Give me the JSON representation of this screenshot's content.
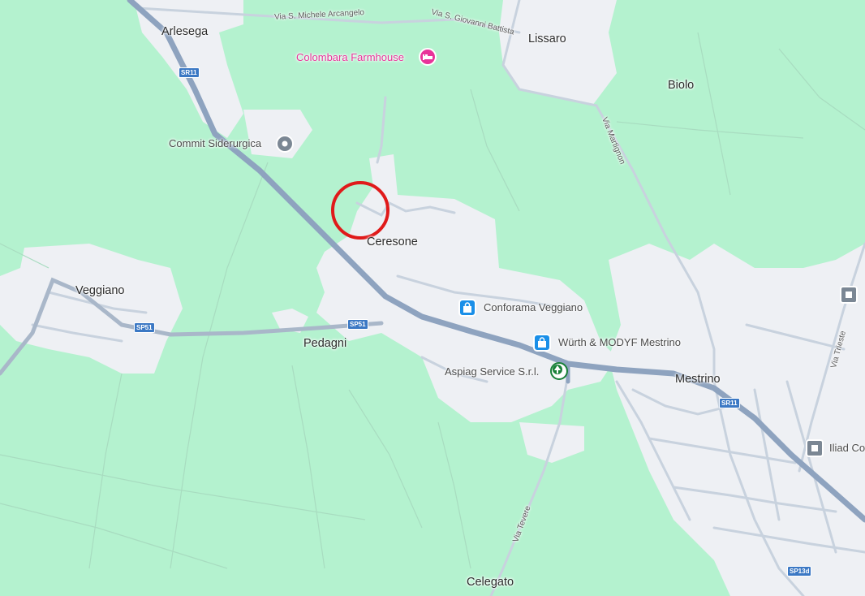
{
  "map": {
    "colors": {
      "land": "#b4f2cf",
      "urban": "#eef0f4",
      "highway": "#8ea3bf",
      "road": "#c8d2de",
      "shopping": "#1a8fe8",
      "lodging": "#e8349a",
      "grocery": "#188038",
      "marker": "#e01a1a"
    },
    "places": {
      "arlesega": "Arlesega",
      "lissaro": "Lissaro",
      "biolo": "Biolo",
      "ceresone": "Ceresone",
      "veggiano": "Veggiano",
      "pedagni": "Pedagni",
      "mestrino": "Mestrino",
      "celegato": "Celegato"
    },
    "streets": {
      "via_s_michele": "Via S. Michele Arcangelo",
      "via_s_giovanni": "Via S. Giovanni Battista",
      "via_martignon": "Via Martignon",
      "via_tevere": "Via Tevere",
      "via_trieste": "Via Trieste"
    },
    "shields": {
      "sr11_a": "SR11",
      "sr11_b": "SR11",
      "sp51_a": "SP51",
      "sp51_b": "SP51",
      "sp13d": "SP13d"
    },
    "pois": {
      "colombara": {
        "label": "Colombara Farmhouse",
        "icon": "bed-icon"
      },
      "commit": {
        "label": "Commit Siderurgica",
        "icon": "pin-icon"
      },
      "conforama": {
        "label": "Conforama Veggiano",
        "icon": "shopping-bag-icon"
      },
      "wurth": {
        "label": "Würth & MODYF Mestrino",
        "icon": "shopping-bag-icon"
      },
      "aspiag": {
        "label": "Aspiag Service S.r.l.",
        "icon": "tree-icon"
      },
      "iliad": {
        "label": "Iliad Co",
        "icon": "square-pin-icon"
      }
    },
    "highlight": {
      "icon": "circle-marker"
    }
  }
}
